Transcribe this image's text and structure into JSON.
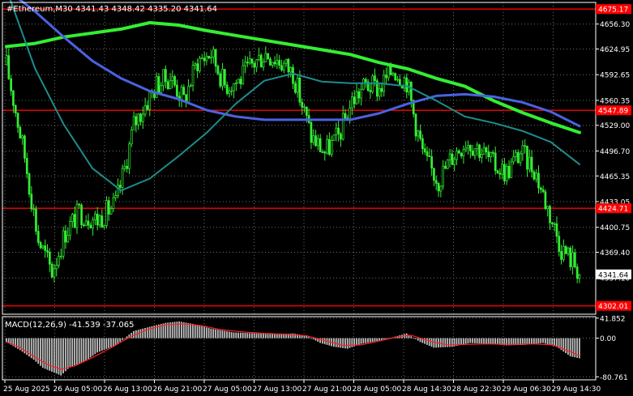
{
  "chart_data": {
    "type": "candlestick",
    "header": {
      "symbol": "#Ethereum,M30",
      "open": "4341.43",
      "high": "4348.42",
      "low": "4335.20",
      "close": "4341.64"
    },
    "price_axis": {
      "range": [
        4291.5,
        4683.5
      ],
      "ticks": [
        "4656.30",
        "4624.95",
        "4592.65",
        "4560.35",
        "4529.00",
        "4496.70",
        "4465.35",
        "4433.05",
        "4400.75",
        "4369.40",
        "4337.10"
      ],
      "current_price": 4341.64,
      "current_label": "4341.64"
    },
    "levels": [
      {
        "value": 4675.17,
        "label": "4675.17"
      },
      {
        "value": 4547.89,
        "label": "4547.89"
      },
      {
        "value": 4424.71,
        "label": "4424.71"
      },
      {
        "value": 4302.01,
        "label": "4302.01"
      }
    ],
    "time_axis": [
      "25 Aug 2025",
      "26 Aug 05:00",
      "26 Aug 13:00",
      "26 Aug 21:00",
      "27 Aug 05:00",
      "27 Aug 13:00",
      "27 Aug 21:00",
      "28 Aug 05:00",
      "28 Aug 14:30",
      "28 Aug 22:30",
      "29 Aug 06:30",
      "29 Aug 14:30"
    ],
    "close_anchors": [
      [
        0,
        4605
      ],
      [
        8,
        4490
      ],
      [
        14,
        4385
      ],
      [
        20,
        4345
      ],
      [
        26,
        4395
      ],
      [
        32,
        4420
      ],
      [
        40,
        4410
      ],
      [
        48,
        4430
      ],
      [
        52,
        4475
      ],
      [
        56,
        4530
      ],
      [
        60,
        4550
      ],
      [
        66,
        4580
      ],
      [
        72,
        4590
      ],
      [
        78,
        4560
      ],
      [
        84,
        4610
      ],
      [
        90,
        4620
      ],
      [
        96,
        4580
      ],
      [
        102,
        4585
      ],
      [
        108,
        4605
      ],
      [
        114,
        4620
      ],
      [
        120,
        4610
      ],
      [
        126,
        4595
      ],
      [
        130,
        4555
      ],
      [
        134,
        4515
      ],
      [
        140,
        4495
      ],
      [
        146,
        4515
      ],
      [
        152,
        4560
      ],
      [
        158,
        4580
      ],
      [
        164,
        4575
      ],
      [
        170,
        4600
      ],
      [
        176,
        4585
      ],
      [
        180,
        4530
      ],
      [
        184,
        4485
      ],
      [
        190,
        4460
      ],
      [
        196,
        4490
      ],
      [
        202,
        4510
      ],
      [
        208,
        4500
      ],
      [
        214,
        4480
      ],
      [
        220,
        4470
      ],
      [
        226,
        4495
      ],
      [
        232,
        4475
      ],
      [
        238,
        4425
      ],
      [
        244,
        4375
      ],
      [
        250,
        4355
      ],
      [
        252,
        4342
      ]
    ],
    "moving_averages": [
      {
        "color": "#33ee33",
        "values": [
          4628,
          4632,
          4640,
          4645,
          4650,
          4658,
          4655,
          4648,
          4642,
          4636,
          4630,
          4624,
          4618,
          4608,
          4600,
          4588,
          4578,
          4560,
          4545,
          4532,
          4520
        ]
      },
      {
        "color": "#4a62e0",
        "values": [
          4700,
          4672,
          4640,
          4610,
          4588,
          4572,
          4562,
          4548,
          4540,
          4536,
          4536,
          4536,
          4536,
          4544,
          4556,
          4566,
          4568,
          4565,
          4558,
          4546,
          4528
        ]
      },
      {
        "color": "#1e8c8c",
        "values": [
          4700,
          4600,
          4530,
          4475,
          4447,
          4462,
          4490,
          4520,
          4556,
          4585,
          4594,
          4584,
          4582,
          4582,
          4578,
          4560,
          4540,
          4532,
          4522,
          4508,
          4480
        ]
      }
    ],
    "macd": {
      "label": "MACD(12,26,9) -41.539 -37.065",
      "range": [
        -87,
        45
      ],
      "ticks": [
        "41.852",
        "0.00",
        "-80.761"
      ],
      "histogram_anchors": [
        [
          0,
          -8
        ],
        [
          6,
          -25
        ],
        [
          12,
          -45
        ],
        [
          16,
          -62
        ],
        [
          20,
          -70
        ],
        [
          24,
          -78
        ],
        [
          28,
          -60
        ],
        [
          34,
          -50
        ],
        [
          40,
          -30
        ],
        [
          48,
          -15
        ],
        [
          56,
          15
        ],
        [
          64,
          25
        ],
        [
          70,
          32
        ],
        [
          76,
          35
        ],
        [
          82,
          30
        ],
        [
          90,
          20
        ],
        [
          100,
          12
        ],
        [
          110,
          10
        ],
        [
          120,
          8
        ],
        [
          126,
          10
        ],
        [
          132,
          5
        ],
        [
          138,
          -10
        ],
        [
          144,
          -18
        ],
        [
          150,
          -22
        ],
        [
          156,
          -12
        ],
        [
          164,
          -5
        ],
        [
          170,
          2
        ],
        [
          176,
          10
        ],
        [
          182,
          -8
        ],
        [
          188,
          -20
        ],
        [
          196,
          -18
        ],
        [
          204,
          -10
        ],
        [
          212,
          -12
        ],
        [
          220,
          -15
        ],
        [
          228,
          -14
        ],
        [
          236,
          -10
        ],
        [
          242,
          -18
        ],
        [
          248,
          -38
        ],
        [
          252,
          -42
        ]
      ],
      "signal_anchors": [
        [
          0,
          -8
        ],
        [
          6,
          -20
        ],
        [
          12,
          -38
        ],
        [
          18,
          -55
        ],
        [
          24,
          -65
        ],
        [
          30,
          -58
        ],
        [
          38,
          -40
        ],
        [
          46,
          -20
        ],
        [
          54,
          2
        ],
        [
          62,
          18
        ],
        [
          70,
          28
        ],
        [
          78,
          30
        ],
        [
          86,
          26
        ],
        [
          94,
          18
        ],
        [
          104,
          13
        ],
        [
          114,
          10
        ],
        [
          124,
          8
        ],
        [
          132,
          5
        ],
        [
          140,
          -5
        ],
        [
          148,
          -15
        ],
        [
          156,
          -14
        ],
        [
          164,
          -6
        ],
        [
          172,
          3
        ],
        [
          178,
          6
        ],
        [
          186,
          -6
        ],
        [
          194,
          -14
        ],
        [
          202,
          -13
        ],
        [
          212,
          -12
        ],
        [
          222,
          -13
        ],
        [
          232,
          -12
        ],
        [
          240,
          -14
        ],
        [
          248,
          -28
        ],
        [
          252,
          -37
        ]
      ]
    }
  }
}
